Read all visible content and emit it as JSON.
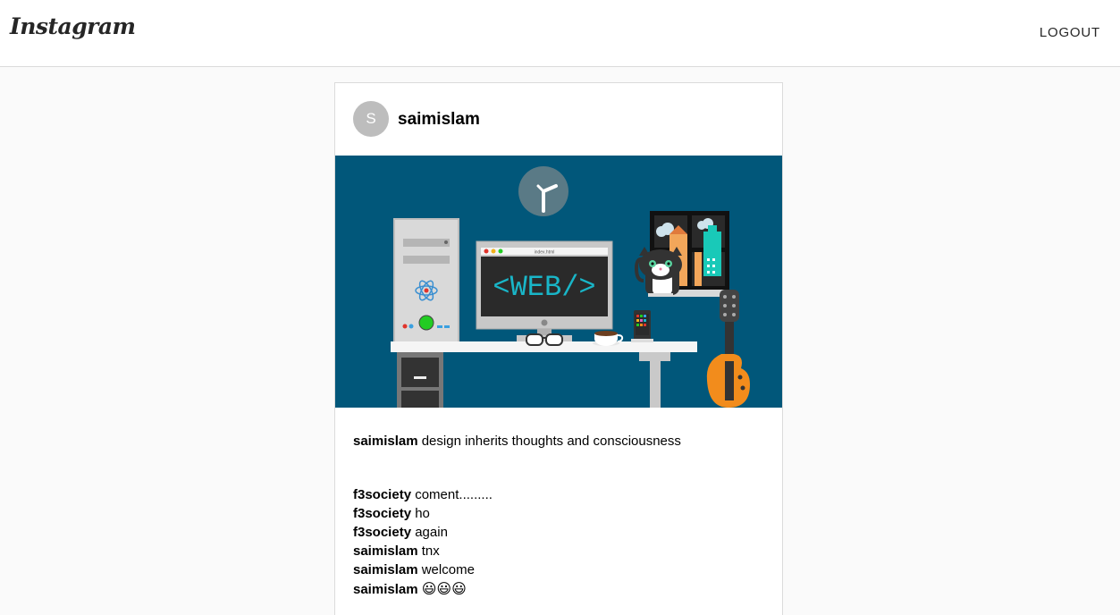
{
  "header": {
    "logo_text": "Instagram",
    "logout_label": "LOGOUT"
  },
  "post": {
    "avatar_letter": "S",
    "username": "saimislam",
    "image": {
      "screen_text": "<WEB/>",
      "screen_title": "index.html",
      "colors": {
        "background": "#01577a",
        "screen": "#2a2a2a",
        "screen_text": "#19b6c8",
        "guitar": "#f28c1c",
        "power_button": "#22cc22"
      }
    },
    "caption": {
      "username": "saimislam",
      "text": "design inherits thoughts and consciousness"
    },
    "comments": [
      {
        "username": "f3society",
        "text": "coment........."
      },
      {
        "username": "f3society",
        "text": "ho"
      },
      {
        "username": "f3society",
        "text": "again"
      },
      {
        "username": "saimislam",
        "text": "tnx"
      },
      {
        "username": "saimislam",
        "text": "welcome"
      },
      {
        "username": "saimislam",
        "text": "😃😃😃"
      }
    ]
  }
}
